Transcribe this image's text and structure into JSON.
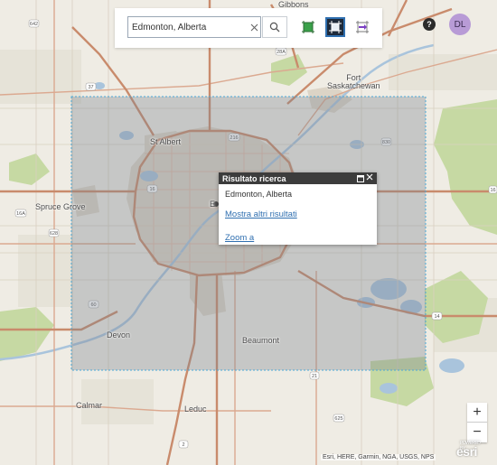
{
  "search": {
    "value": "Edmonton, Alberta"
  },
  "user": {
    "initials": "DL"
  },
  "help_label": "?",
  "popup": {
    "title": "Risultato ricerca",
    "result": "Edmonton, Alberta",
    "more_results": "Mostra altri risultati",
    "zoom_to": "Zoom a"
  },
  "map": {
    "place_labels": {
      "gibbons": "Gibbons",
      "fort_saskatchewan": "Fort\nSaskatchewan",
      "st_albert": "St Albert",
      "spruce_grove": "Spruce Grove",
      "edmonton_partial": "E",
      "devon": "Devon",
      "beaumont": "Beaumont",
      "calmar": "Calmar",
      "leduc": "Leduc"
    },
    "highway_shields": [
      "642",
      "37",
      "28A",
      "216",
      "830",
      "16",
      "16A",
      "628",
      "60",
      "14",
      "21",
      "625",
      "2",
      "16"
    ],
    "colors": {
      "background": "#efece4",
      "highway": "#c98b6c",
      "arterial": "#e0b6a0",
      "water": "#a9c4dc",
      "urban": "#dcd4c6",
      "green": "#c6d9a3",
      "extent_fill": "#7a8390",
      "extent_border": "#4aa8d8",
      "link": "#2f6fb0",
      "popup_header": "#3c3c3c"
    }
  },
  "zoom": {
    "in_label": "+",
    "out_label": "−"
  },
  "attribution": "Esri, HERE, Garmin, NGA, USGS, NPS",
  "logo": {
    "small": "POWERED BY",
    "text": "esri"
  }
}
